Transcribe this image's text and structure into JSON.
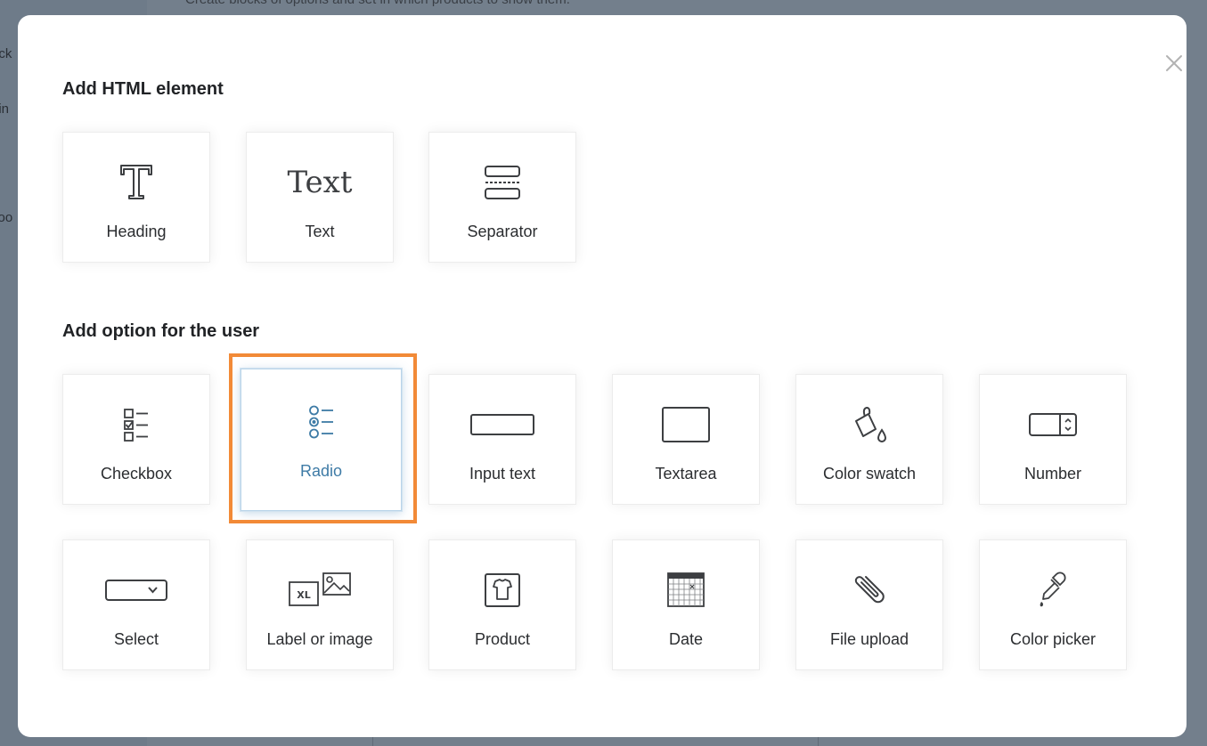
{
  "background": {
    "hint_text": "Create blocks of options and set in which products to show them.",
    "sidebar_fragments": [
      "ock",
      "ttin",
      "Too"
    ]
  },
  "modal": {
    "close_label": "×",
    "sections": [
      {
        "title": "Add HTML element",
        "items": [
          {
            "label": "Heading",
            "icon": "heading-icon"
          },
          {
            "label": "Text",
            "icon": "text-icon",
            "glyph": "Text"
          },
          {
            "label": "Separator",
            "icon": "separator-icon"
          }
        ]
      },
      {
        "title": "Add option for the user",
        "items": [
          {
            "label": "Checkbox",
            "icon": "checkbox-icon"
          },
          {
            "label": "Radio",
            "icon": "radio-icon",
            "selected": true
          },
          {
            "label": "Input text",
            "icon": "input-text-icon"
          },
          {
            "label": "Textarea",
            "icon": "textarea-icon"
          },
          {
            "label": "Color swatch",
            "icon": "color-swatch-icon"
          },
          {
            "label": "Number",
            "icon": "number-icon"
          },
          {
            "label": "Select",
            "icon": "select-icon"
          },
          {
            "label": "Label or image",
            "icon": "label-or-image-icon",
            "badge": "XL"
          },
          {
            "label": "Product",
            "icon": "product-icon"
          },
          {
            "label": "Date",
            "icon": "date-icon"
          },
          {
            "label": "File upload",
            "icon": "file-upload-icon"
          },
          {
            "label": "Color picker",
            "icon": "color-picker-icon"
          }
        ]
      }
    ]
  },
  "colors": {
    "highlight": "#f28a37",
    "selected_label": "#3e7ba6",
    "overlay": "#6e7b89"
  }
}
